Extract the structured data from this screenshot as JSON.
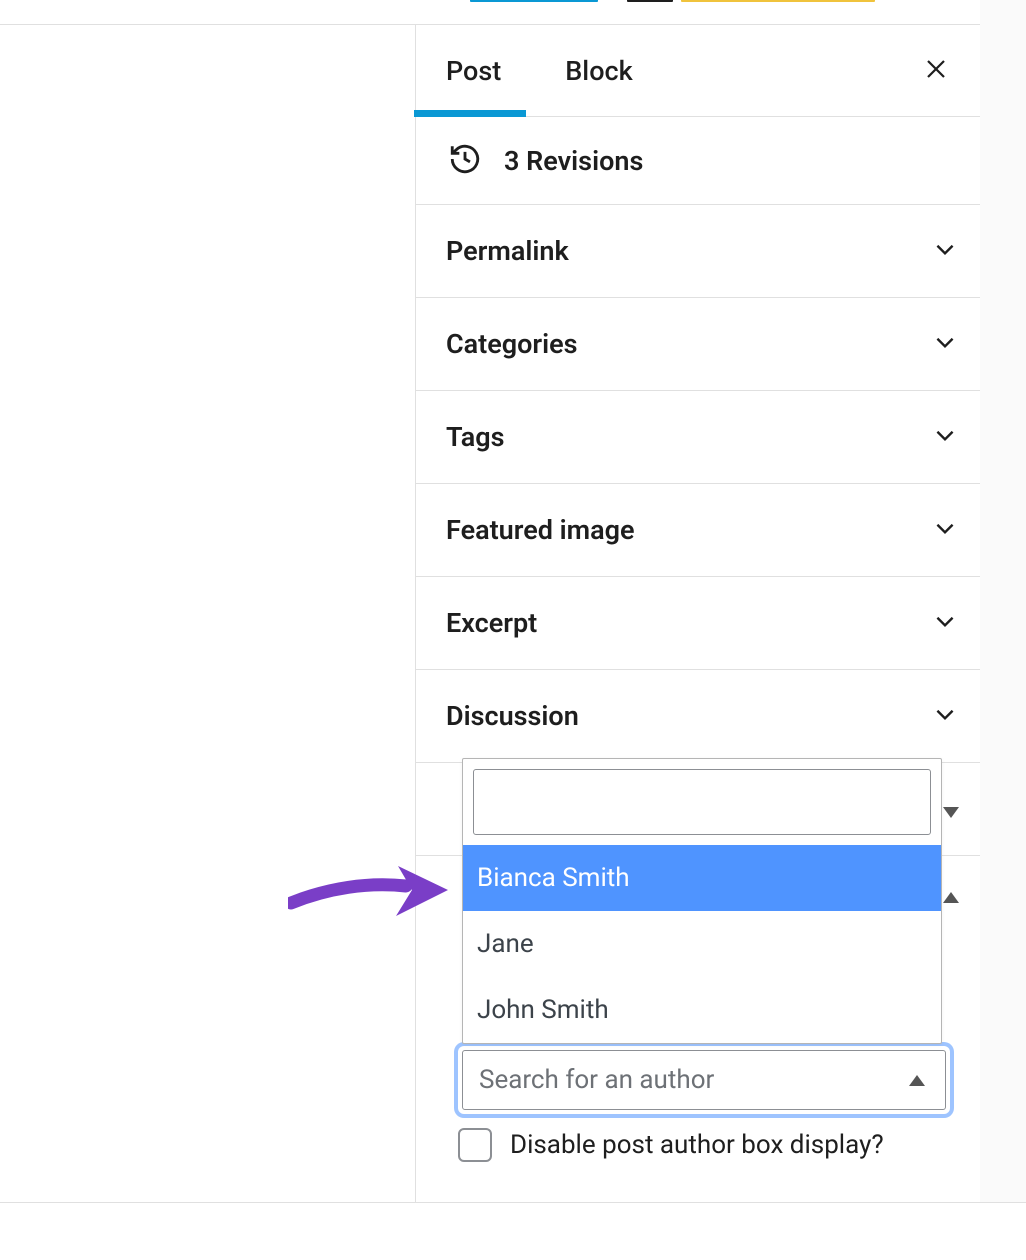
{
  "tabs": {
    "post": "Post",
    "block": "Block"
  },
  "revisions": {
    "label": "3 Revisions"
  },
  "panels": {
    "permalink": "Permalink",
    "categories": "Categories",
    "tags": "Tags",
    "featured_image": "Featured image",
    "excerpt": "Excerpt",
    "discussion": "Discussion"
  },
  "author_dropdown": {
    "options": {
      "0": "Bianca Smith",
      "1": "Jane",
      "2": "John Smith"
    }
  },
  "author_combobox": {
    "placeholder": "Search for an author"
  },
  "disable_author_box": {
    "label": "Disable post author box display?"
  }
}
